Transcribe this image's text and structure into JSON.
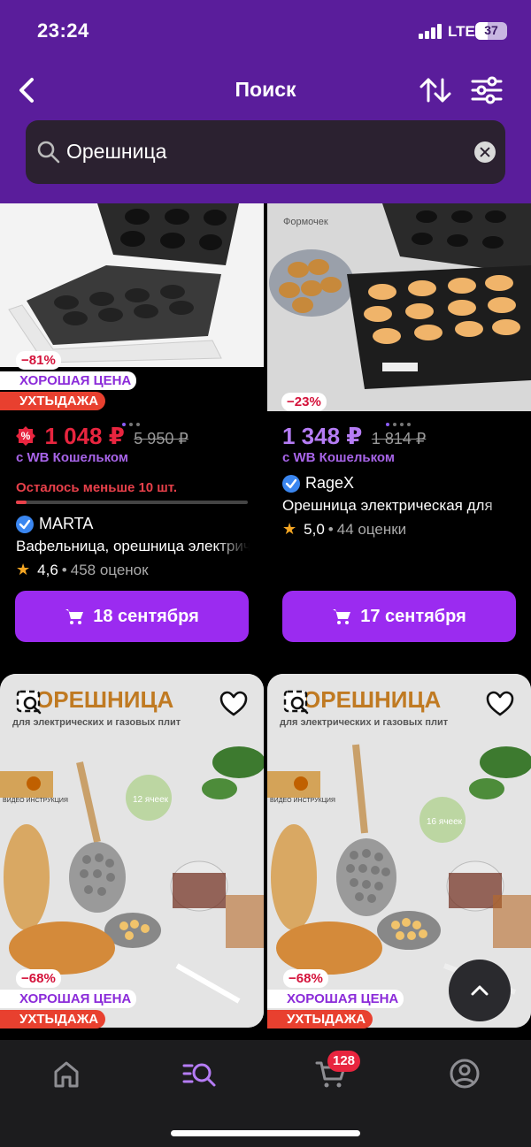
{
  "status_bar": {
    "time": "23:24",
    "network": "LTE",
    "battery": "37"
  },
  "header": {
    "title": "Поиск"
  },
  "search": {
    "query": "Орешница"
  },
  "products": [
    {
      "discount": "−81%",
      "tag_good": "ХОРОШАЯ ЦЕНА",
      "tag_hot": "УХТЫДАЖА",
      "price": "1 048 ₽",
      "old_price": "5 950 ₽",
      "wallet": "с WB Кошельком",
      "stock_note": "Осталось меньше 10 шт.",
      "brand": "MARTA",
      "name": "Вафельница, орешница электрическая",
      "rating": "4,6",
      "reviews": "458 оценок",
      "delivery": "18 сентября"
    },
    {
      "discount": "−23%",
      "price": "1 348 ₽",
      "old_price": "1 814 ₽",
      "wallet": "с WB Кошельком",
      "brand": "RageX",
      "name": "Орешница электрическая для",
      "rating": "5,0",
      "reviews": "44 оценки",
      "delivery": "17 сентября",
      "image_caption": "Формочек"
    },
    {
      "discount": "−68%",
      "tag_good": "ХОРОШАЯ ЦЕНА",
      "tag_hot": "УХТЫДАЖА",
      "image_title": "ОРЕШНИЦА",
      "image_sub": "для электрических и газовых плит",
      "image_cells": "12 ячеек",
      "image_video": "ВИДЕО ИНСТРУКЦИЯ"
    },
    {
      "discount": "−68%",
      "tag_good": "ХОРОШАЯ ЦЕНА",
      "tag_hot": "УХТЫДАЖА",
      "image_title": "ОРЕШНИЦА",
      "image_sub": "для электрических и газовых плит",
      "image_cells": "16 ячеек",
      "image_video": "ВИДЕО ИНСТРУКЦИЯ"
    }
  ],
  "tabbar": {
    "cart_count": "128"
  },
  "colors": {
    "header": "#5a1d9b",
    "accent": "#9b2bf0",
    "price_red": "#e8253f",
    "price_purple": "#b57cf5"
  }
}
